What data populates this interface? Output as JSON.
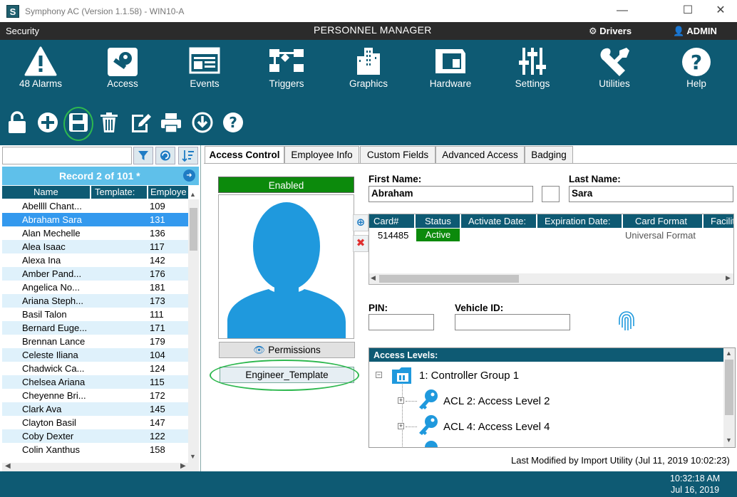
{
  "window": {
    "logo_letter": "S",
    "title": "Symphony AC  (Version 1.1.58) - WIN10-A",
    "minimize": "—",
    "maximize": "☐",
    "close": "✕"
  },
  "menubar": {
    "security": "Security",
    "center_title": "PERSONNEL MANAGER",
    "drivers": "Drivers",
    "admin": "ADMIN"
  },
  "nav": {
    "alarms": "48 Alarms",
    "access": "Access",
    "events": "Events",
    "triggers": "Triggers",
    "graphics": "Graphics",
    "hardware": "Hardware",
    "settings": "Settings",
    "utilities": "Utilities",
    "help": "Help"
  },
  "search": {
    "value": ""
  },
  "record": {
    "text": "Record 2 of 101 *"
  },
  "grid": {
    "columns": [
      "Name",
      "Template:",
      "Employe"
    ],
    "rows": [
      {
        "name": "Abellll Chant...",
        "tmpl": "109"
      },
      {
        "name": "Abraham Sara",
        "tmpl": "131"
      },
      {
        "name": "Alan Mechelle",
        "tmpl": "136"
      },
      {
        "name": "Alea Isaac",
        "tmpl": "117"
      },
      {
        "name": "Alexa Ina",
        "tmpl": "142"
      },
      {
        "name": "Amber Pand...",
        "tmpl": "176"
      },
      {
        "name": "Angelica No...",
        "tmpl": "181"
      },
      {
        "name": "Ariana Steph...",
        "tmpl": "173"
      },
      {
        "name": "Basil Talon",
        "tmpl": "111"
      },
      {
        "name": "Bernard Euge...",
        "tmpl": "171"
      },
      {
        "name": "Brennan Lance",
        "tmpl": "179"
      },
      {
        "name": "Celeste Iliana",
        "tmpl": "104"
      },
      {
        "name": "Chadwick Ca...",
        "tmpl": "124"
      },
      {
        "name": "Chelsea Ariana",
        "tmpl": "115"
      },
      {
        "name": "Cheyenne Bri...",
        "tmpl": "172"
      },
      {
        "name": "Clark Ava",
        "tmpl": "145"
      },
      {
        "name": "Clayton Basil",
        "tmpl": "147"
      },
      {
        "name": "Coby Dexter",
        "tmpl": "122"
      },
      {
        "name": "Colin Xanthus",
        "tmpl": "158"
      }
    ]
  },
  "tabs": [
    "Access Control",
    "Employee Info",
    "Custom Fields",
    "Advanced Access",
    "Badging"
  ],
  "person": {
    "status": "Enabled",
    "permissions": "Permissions",
    "template": "Engineer_Template",
    "first_name_label": "First Name:",
    "first_name": "Abraham",
    "middle": "",
    "last_name_label": "Last Name:",
    "last_name": "Sara",
    "pin_label": "PIN:",
    "pin": "",
    "vehicle_label": "Vehicle ID:",
    "vehicle": ""
  },
  "cards": {
    "columns": [
      "Card#",
      "Status",
      "Activate Date:",
      "Expiration Date:",
      "Card Format",
      "Facilit"
    ],
    "row": {
      "card": "514485",
      "status": "Active",
      "activate": "",
      "expire": "",
      "format": "Universal Format"
    }
  },
  "access_levels": {
    "title": "Access Levels:",
    "group": "1:  Controller Group 1",
    "levels": [
      "ACL 2:  Access Level 2",
      "ACL 4:  Access Level 4"
    ]
  },
  "footer": {
    "last_modified": "Last Modified by Import Utility (Jul 11, 2019  10:02:23)"
  },
  "status": {
    "time": "10:32:18 AM",
    "date": "Jul 16, 2019"
  }
}
